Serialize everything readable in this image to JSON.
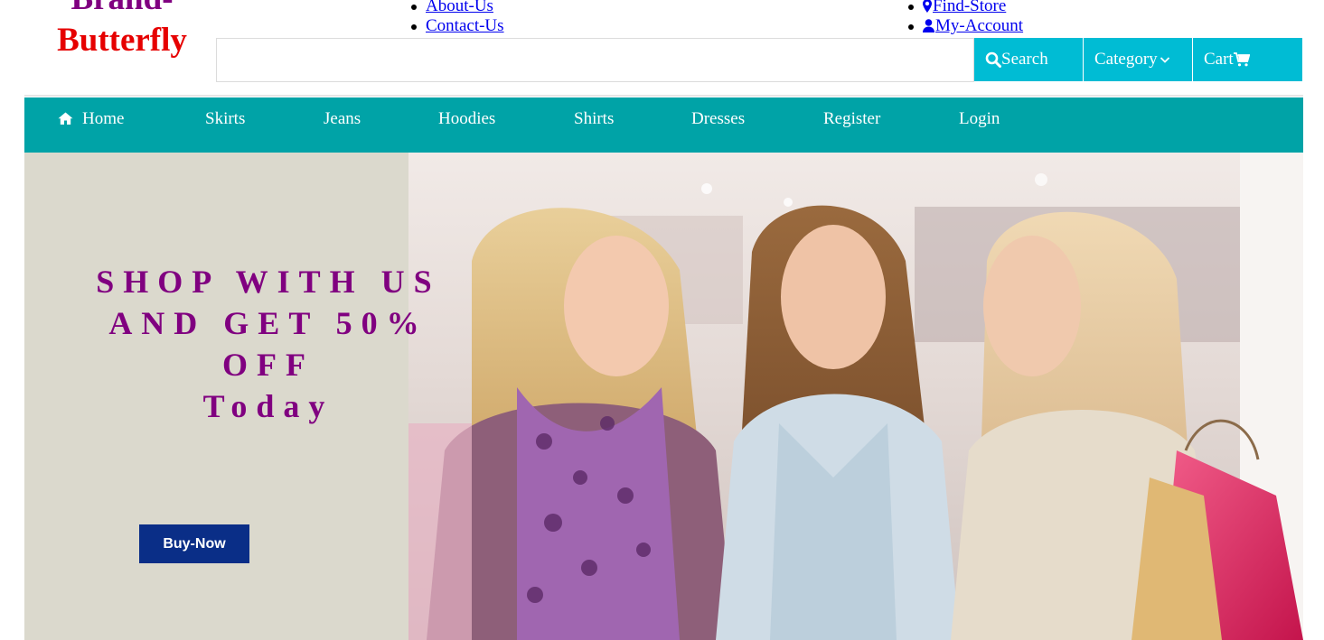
{
  "brand": {
    "line1": "Brand-",
    "line2": "Butterfly",
    "color_line1": "#800080",
    "color_line2": "#e60000"
  },
  "top_links_left": [
    {
      "label": "About-Us"
    },
    {
      "label": "Contact-Us"
    }
  ],
  "top_links_right": [
    {
      "label": "Find-Store",
      "icon": "map-marker-icon"
    },
    {
      "label": "My-Account",
      "icon": "user-icon"
    }
  ],
  "search": {
    "value": "",
    "placeholder": "",
    "search_label": "Search",
    "category_label": "Category",
    "cart_label": "Cart",
    "accent": "#00bcd4"
  },
  "nav": {
    "background": "#00a3a7",
    "items": [
      {
        "label": "Home",
        "icon": "home-icon"
      },
      {
        "label": "Skirts"
      },
      {
        "label": "Jeans"
      },
      {
        "label": "Hoodies"
      },
      {
        "label": "Shirts"
      },
      {
        "label": "Dresses"
      },
      {
        "label": "Register"
      },
      {
        "label": "Login"
      }
    ]
  },
  "hero": {
    "promo_line1": "SHOP WITH US",
    "promo_line2": "AND GET 50%",
    "promo_line3": "OFF",
    "promo_line4": "Today",
    "promo_color": "#800080",
    "buy_label": "Buy-Now",
    "buy_color": "#0a2e87",
    "photo": "three-women-shopping-photo"
  }
}
